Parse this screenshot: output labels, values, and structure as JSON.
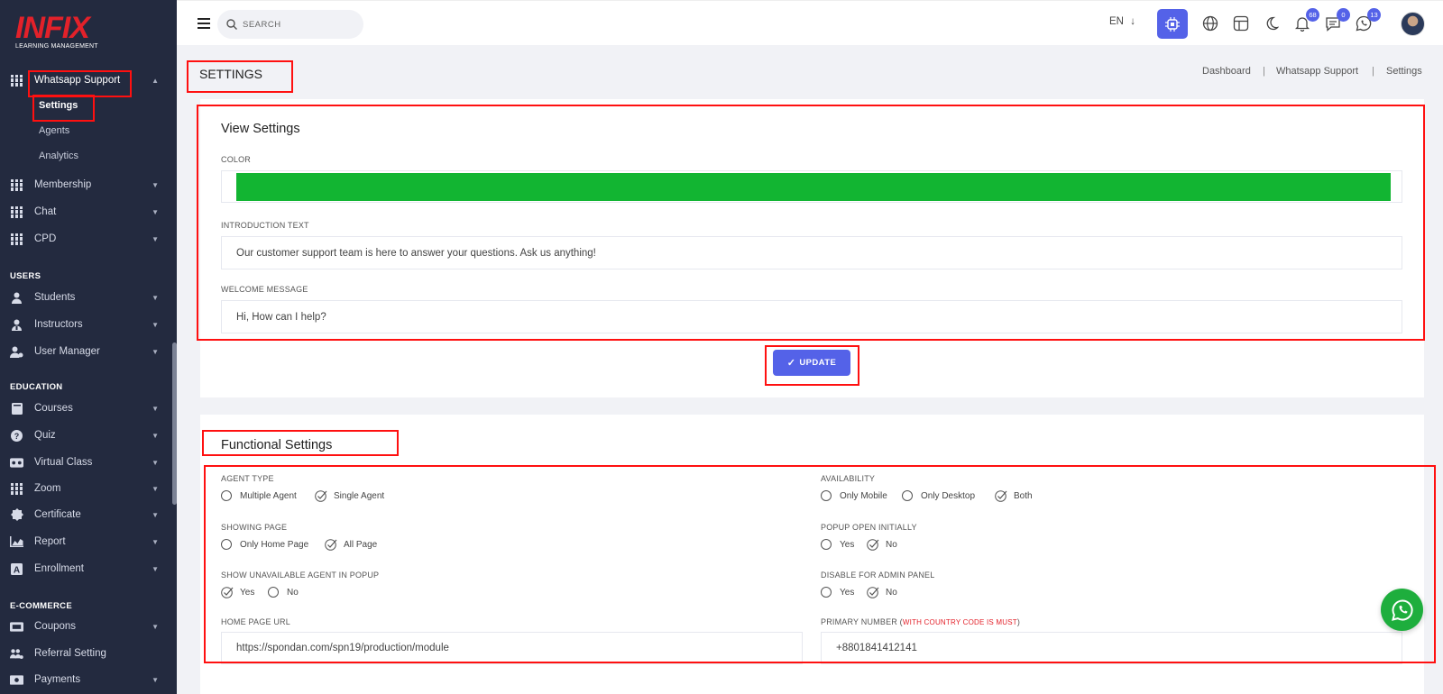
{
  "brand": {
    "name": "INFIX",
    "tagline": "LEARNING MANAGEMENT"
  },
  "sidebar": {
    "active_group": {
      "label": "Whatsapp Support",
      "children": [
        "Settings",
        "Agents",
        "Analytics"
      ]
    },
    "groups": [
      "Membership",
      "Chat",
      "CPD"
    ],
    "sections": [
      {
        "title": "USERS",
        "items": [
          "Students",
          "Instructors",
          "User Manager"
        ]
      },
      {
        "title": "EDUCATION",
        "items": [
          "Courses",
          "Quiz",
          "Virtual Class",
          "Zoom",
          "Certificate",
          "Report",
          "Enrollment"
        ]
      },
      {
        "title": "E-COMMERCE",
        "items": [
          "Coupons",
          "Referral Setting",
          "Payments"
        ]
      }
    ]
  },
  "topbar": {
    "search_placeholder": "SEARCH",
    "language": "EN",
    "notifications_count": "68",
    "messages_count": "0",
    "whatsapp_count": "13"
  },
  "page": {
    "title": "SETTINGS",
    "breadcrumb": [
      "Dashboard",
      "Whatsapp Support",
      "Settings"
    ]
  },
  "view_settings": {
    "heading": "View Settings",
    "color_label": "COLOR",
    "color_value": "#12b532",
    "intro_label": "INTRODUCTION TEXT",
    "intro_value": "Our customer support team is here to answer your questions. Ask us anything!",
    "welcome_label": "WELCOME MESSAGE",
    "welcome_value": "Hi, How can I help?",
    "update_button": "UPDATE"
  },
  "functional_settings": {
    "heading": "Functional Settings",
    "agent_type": {
      "label": "AGENT TYPE",
      "options": [
        "Multiple Agent",
        "Single Agent"
      ],
      "selected": "Single Agent"
    },
    "availability": {
      "label": "AVAILABILITY",
      "options": [
        "Only Mobile",
        "Only Desktop",
        "Both"
      ],
      "selected": "Both"
    },
    "showing_page": {
      "label": "SHOWING PAGE",
      "options": [
        "Only Home Page",
        "All Page"
      ],
      "selected": "All Page"
    },
    "popup_open": {
      "label": "POPUP OPEN INITIALLY",
      "options": [
        "Yes",
        "No"
      ],
      "selected": "No"
    },
    "show_unavailable": {
      "label": "SHOW UNAVAILABLE AGENT IN POPUP",
      "options": [
        "Yes",
        "No"
      ],
      "selected": "Yes"
    },
    "disable_admin": {
      "label": "DISABLE FOR ADMIN PANEL",
      "options": [
        "Yes",
        "No"
      ],
      "selected": "No"
    },
    "home_url_label": "HOME PAGE URL",
    "home_url_value": "https://spondan.com/spn19/production/module",
    "primary_number_label": "PRIMARY NUMBER (",
    "primary_number_note": "WITH COUNTRY CODE IS MUST",
    "primary_number_label_end": ")",
    "primary_number_value": "+8801841412141"
  },
  "colors": {
    "accent": "#5462e8",
    "sidebar": "#232a3f",
    "highlight_box": "#ff1010",
    "whatsapp": "#1eae3d",
    "brand_red": "#e3212a"
  }
}
